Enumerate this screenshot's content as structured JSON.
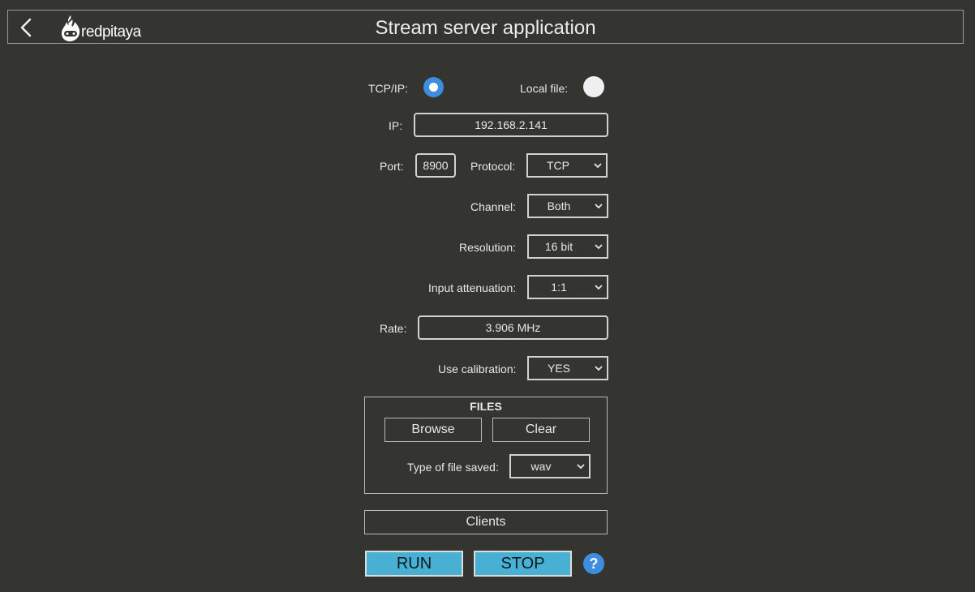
{
  "header": {
    "title": "Stream server application",
    "logo_text": "redpitaya"
  },
  "mode": {
    "tcp_label": "TCP/IP:",
    "tcp_selected": true,
    "local_label": "Local file:",
    "local_selected": false
  },
  "ip": {
    "label": "IP:",
    "value": "192.168.2.141"
  },
  "port": {
    "label": "Port:",
    "value": "8900"
  },
  "protocol": {
    "label": "Protocol:",
    "value": "TCP"
  },
  "channel": {
    "label": "Channel:",
    "value": "Both"
  },
  "resolution": {
    "label": "Resolution:",
    "value": "16 bit"
  },
  "attenuation": {
    "label": "Input attenuation:",
    "value": "1:1"
  },
  "rate": {
    "label": "Rate:",
    "value": "3.906 MHz"
  },
  "calibration": {
    "label": "Use calibration:",
    "value": "YES"
  },
  "files": {
    "title": "FILES",
    "browse_label": "Browse",
    "clear_label": "Clear",
    "type_label": "Type of file saved:",
    "type_value": "wav"
  },
  "clients": {
    "label": "Clients"
  },
  "actions": {
    "run_label": "RUN",
    "stop_label": "STOP",
    "help_label": "?"
  },
  "colors": {
    "background": "#343431",
    "accent": "#48b0d2",
    "radio_selected": "#3e8de0"
  }
}
